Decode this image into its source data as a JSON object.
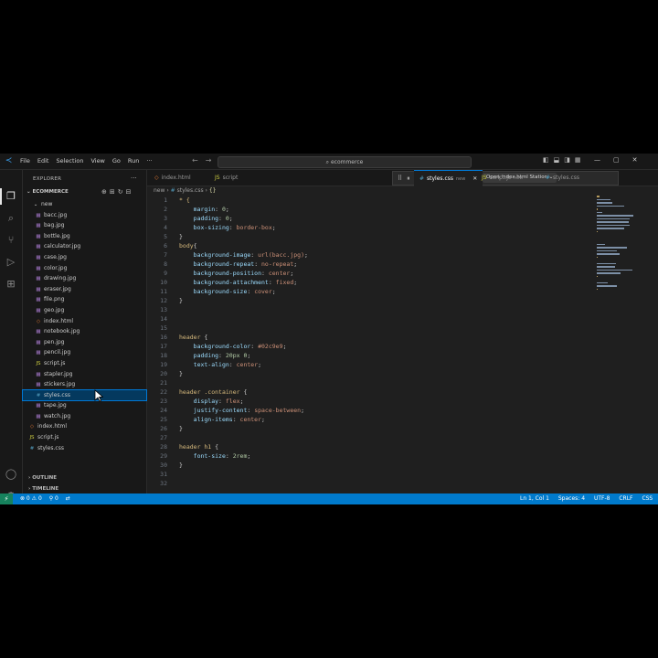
{
  "colors": {
    "accent": "#0078d4",
    "statusbar": "#007acc",
    "selection": "#04395e",
    "background": "#1f1f1f"
  },
  "menu": [
    "File",
    "Edit",
    "Selection",
    "View",
    "Go",
    "Run",
    "···"
  ],
  "command_center": {
    "text": "ecommerce",
    "icon": "search-icon"
  },
  "window_controls": [
    "—",
    "▢",
    "✕"
  ],
  "activity_bar": [
    "files-icon",
    "search-icon",
    "source-control-icon",
    "run-debug-icon",
    "extensions-icon",
    "account-icon",
    "settings-gear-icon"
  ],
  "sidebar": {
    "title": "EXPLORER",
    "more": "···",
    "folder": "ECOMMERCE",
    "subfolder": "new",
    "files": [
      {
        "name": "bacc.jpg",
        "type": "img"
      },
      {
        "name": "bag.jpg",
        "type": "img"
      },
      {
        "name": "bottle.jpg",
        "type": "img"
      },
      {
        "name": "calculator.jpg",
        "type": "img"
      },
      {
        "name": "case.jpg",
        "type": "img"
      },
      {
        "name": "color.jpg",
        "type": "img"
      },
      {
        "name": "drawing.jpg",
        "type": "img"
      },
      {
        "name": "eraser.jpg",
        "type": "img"
      },
      {
        "name": "file.png",
        "type": "img"
      },
      {
        "name": "geo.jpg",
        "type": "img"
      },
      {
        "name": "index.html",
        "type": "html"
      },
      {
        "name": "notebook.jpg",
        "type": "img"
      },
      {
        "name": "pen.jpg",
        "type": "img"
      },
      {
        "name": "pencil.jpg",
        "type": "img"
      },
      {
        "name": "script.js",
        "type": "js"
      },
      {
        "name": "stapler.jpg",
        "type": "img"
      },
      {
        "name": "stickers.jpg",
        "type": "img"
      },
      {
        "name": "styles.css",
        "type": "css",
        "selected": true
      },
      {
        "name": "tape.jpg",
        "type": "img"
      },
      {
        "name": "watch.jpg",
        "type": "img"
      }
    ],
    "root_files": [
      {
        "name": "index.html",
        "type": "html"
      },
      {
        "name": "script.js",
        "type": "js"
      },
      {
        "name": "styles.css",
        "type": "css"
      }
    ],
    "outline": "OUTLINE",
    "timeline": "TIMELINE"
  },
  "tabs": {
    "t1": "index.html",
    "t2": "script",
    "active": "styles.css",
    "active_sub": "new",
    "t4": "script.js",
    "t4_sub": "new",
    "t5": "styles.css"
  },
  "debug": {
    "task": "Open index.html Station ⌄"
  },
  "breadcrumb": {
    "folder": "new",
    "file": "styles.css",
    "symbol": "{}"
  },
  "editor": {
    "lines": [
      [
        [
          "sel-css",
          "* {"
        ]
      ],
      [
        [
          "prop",
          "    margin"
        ],
        [
          "punc",
          ": "
        ],
        [
          "num",
          "0"
        ],
        [
          "punc",
          ";"
        ]
      ],
      [
        [
          "prop",
          "    padding"
        ],
        [
          "punc",
          ": "
        ],
        [
          "num",
          "0"
        ],
        [
          "punc",
          ";"
        ]
      ],
      [
        [
          "prop",
          "    box-sizing"
        ],
        [
          "punc",
          ": "
        ],
        [
          "val",
          "border-box"
        ],
        [
          "punc",
          ";"
        ]
      ],
      [
        [
          "punc",
          "}"
        ]
      ],
      [
        [
          "sel-css",
          "body"
        ],
        [
          "punc",
          "{"
        ]
      ],
      [
        [
          "prop",
          "    background-image"
        ],
        [
          "punc",
          ": "
        ],
        [
          "val",
          "url(bacc.jpg)"
        ],
        [
          "punc",
          ";"
        ]
      ],
      [
        [
          "prop",
          "    background-repeat"
        ],
        [
          "punc",
          ": "
        ],
        [
          "val",
          "no-repeat"
        ],
        [
          "punc",
          ";"
        ]
      ],
      [
        [
          "prop",
          "    background-position"
        ],
        [
          "punc",
          ": "
        ],
        [
          "val",
          "center"
        ],
        [
          "punc",
          ";"
        ]
      ],
      [
        [
          "prop",
          "    background-attachment"
        ],
        [
          "punc",
          ": "
        ],
        [
          "val",
          "fixed"
        ],
        [
          "punc",
          ";"
        ]
      ],
      [
        [
          "prop",
          "    background-size"
        ],
        [
          "punc",
          ": "
        ],
        [
          "val",
          "cover"
        ],
        [
          "punc",
          ";"
        ]
      ],
      [
        [
          "punc",
          "}"
        ]
      ],
      [],
      [],
      [],
      [
        [
          "sel-css",
          "header"
        ],
        [
          "punc",
          " {"
        ]
      ],
      [
        [
          "prop",
          "    background-color"
        ],
        [
          "punc",
          ": "
        ],
        [
          "val",
          "#02c9e9"
        ],
        [
          "punc",
          ";"
        ]
      ],
      [
        [
          "prop",
          "    padding"
        ],
        [
          "punc",
          ": "
        ],
        [
          "num",
          "20px 0"
        ],
        [
          "punc",
          ";"
        ]
      ],
      [
        [
          "prop",
          "    text-align"
        ],
        [
          "punc",
          ": "
        ],
        [
          "val",
          "center"
        ],
        [
          "punc",
          ";"
        ]
      ],
      [
        [
          "punc",
          "}"
        ]
      ],
      [],
      [
        [
          "sel-css",
          "header .container"
        ],
        [
          "punc",
          " {"
        ]
      ],
      [
        [
          "prop",
          "    display"
        ],
        [
          "punc",
          ": "
        ],
        [
          "val",
          "flex"
        ],
        [
          "punc",
          ";"
        ]
      ],
      [
        [
          "prop",
          "    justify-content"
        ],
        [
          "punc",
          ": "
        ],
        [
          "val",
          "space-between"
        ],
        [
          "punc",
          ";"
        ]
      ],
      [
        [
          "prop",
          "    align-items"
        ],
        [
          "punc",
          ": "
        ],
        [
          "val",
          "center"
        ],
        [
          "punc",
          ";"
        ]
      ],
      [
        [
          "punc",
          "}"
        ]
      ],
      [],
      [
        [
          "sel-css",
          "header h1"
        ],
        [
          "punc",
          " {"
        ]
      ],
      [
        [
          "prop",
          "    font-size"
        ],
        [
          "punc",
          ": "
        ],
        [
          "num",
          "2rem"
        ],
        [
          "punc",
          ";"
        ]
      ],
      [
        [
          "punc",
          "}"
        ]
      ],
      [],
      []
    ]
  },
  "statusbar": {
    "problems": "⊗ 0 ⚠ 0",
    "ports": "⚲ 0",
    "position": "Ln 1, Col 1",
    "spaces": "Spaces: 4",
    "encoding": "UTF-8",
    "eol": "CRLF",
    "language": "CSS",
    "bell": "🔔"
  }
}
